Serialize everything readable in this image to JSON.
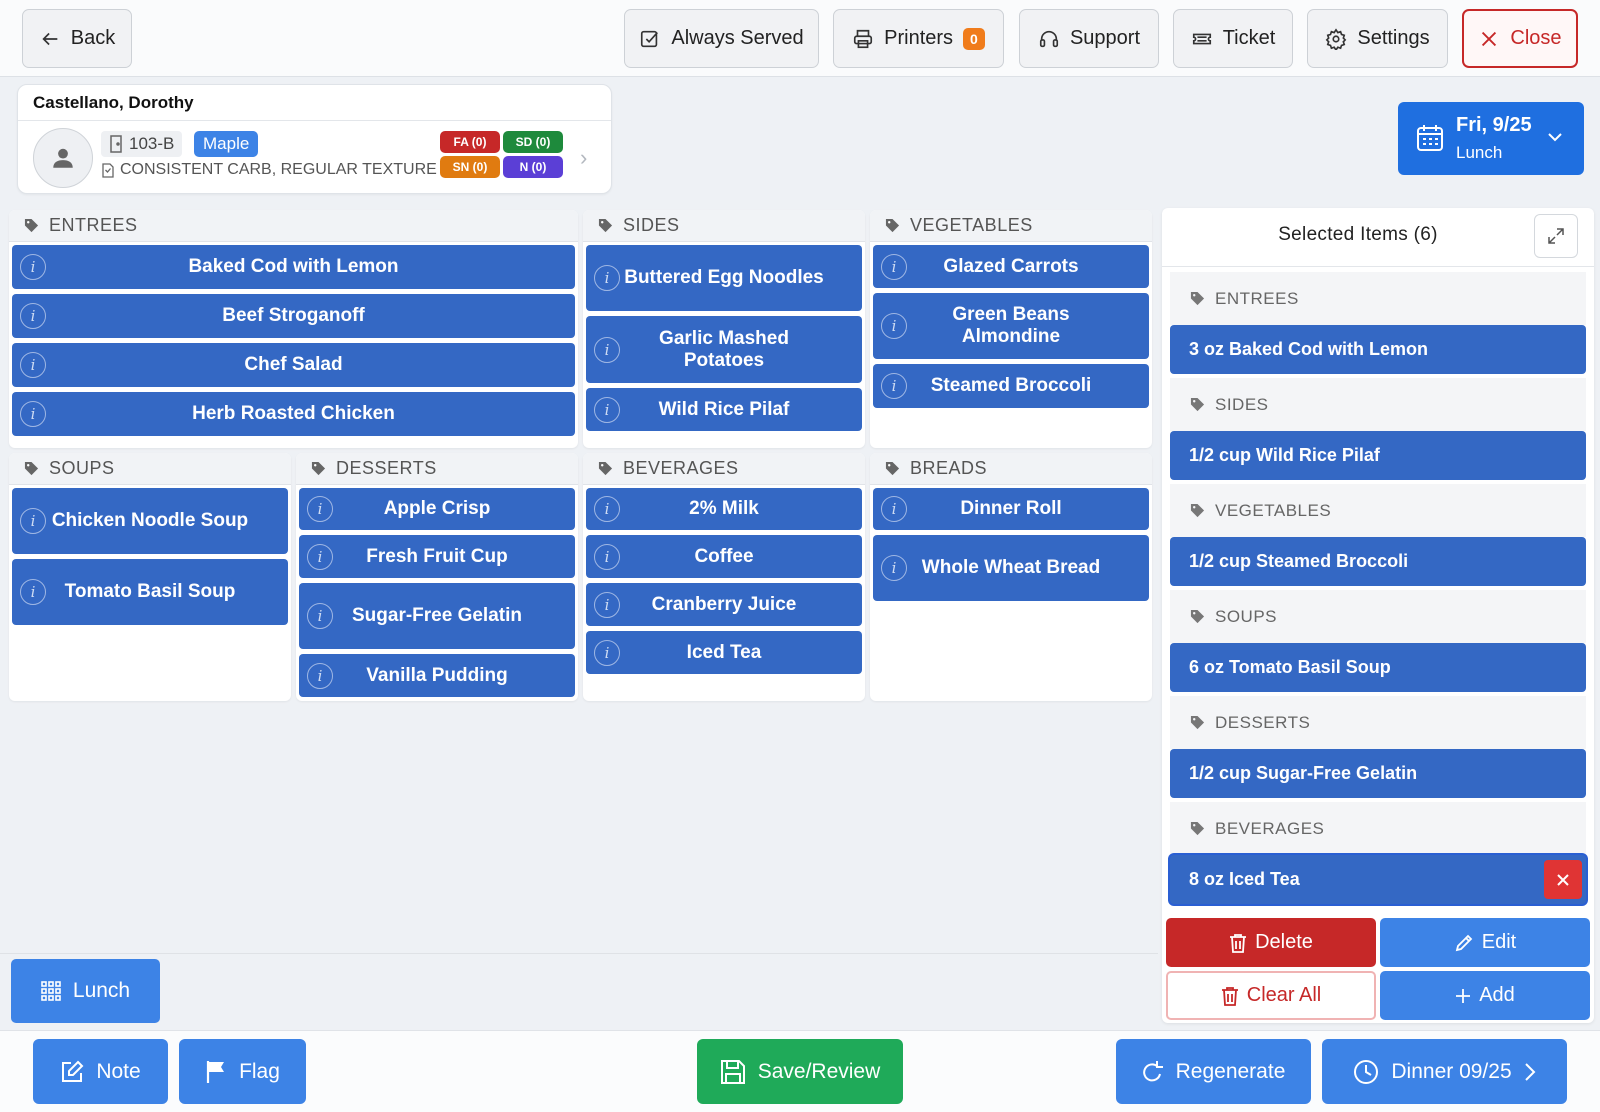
{
  "toolbar": {
    "back": "Back",
    "always_served": "Always Served",
    "printers": "Printers",
    "printers_count": "0",
    "support": "Support",
    "ticket": "Ticket",
    "settings": "Settings",
    "close": "Close"
  },
  "patient": {
    "name": "Castellano, Dorothy",
    "room": "103-B",
    "unit": "Maple",
    "diet": "CONSISTENT CARB, REGULAR TEXTURE",
    "tags": [
      {
        "label": "FA (0)",
        "color": "#c62828"
      },
      {
        "label": "SD (0)",
        "color": "#1e8a3c"
      },
      {
        "label": "SN (0)",
        "color": "#e07b10"
      },
      {
        "label": "N (0)",
        "color": "#5b3fd6"
      }
    ]
  },
  "date": {
    "day": "Fri, 9/25",
    "meal": "Lunch"
  },
  "menu": {
    "entrees": {
      "title": "ENTREES",
      "items": [
        "Baked Cod with Lemon",
        "Beef Stroganoff",
        "Chef Salad",
        "Herb Roasted Chicken"
      ]
    },
    "sides": {
      "title": "SIDES",
      "items": [
        "Buttered Egg Noodles",
        "Garlic Mashed Potatoes",
        "Wild Rice Pilaf"
      ]
    },
    "vegetables": {
      "title": "VEGETABLES",
      "items": [
        "Glazed Carrots",
        "Green Beans Almondine",
        "Steamed Broccoli"
      ]
    },
    "soups": {
      "title": "SOUPS",
      "items": [
        "Chicken Noodle Soup",
        "Tomato Basil Soup"
      ]
    },
    "desserts": {
      "title": "DESSERTS",
      "items": [
        "Apple Crisp",
        "Fresh Fruit Cup",
        "Sugar-Free Gelatin",
        "Vanilla Pudding"
      ]
    },
    "beverages": {
      "title": "BEVERAGES",
      "items": [
        "2% Milk",
        "Coffee",
        "Cranberry Juice",
        "Iced Tea"
      ]
    },
    "breads": {
      "title": "BREADS",
      "items": [
        "Dinner Roll",
        "Whole Wheat Bread"
      ]
    }
  },
  "selected": {
    "title": "Selected Items (6)",
    "groups": [
      {
        "category": "ENTREES",
        "item": "3 oz Baked Cod with Lemon"
      },
      {
        "category": "SIDES",
        "item": "1/2 cup Wild Rice Pilaf"
      },
      {
        "category": "VEGETABLES",
        "item": "1/2 cup Steamed Broccoli"
      },
      {
        "category": "SOUPS",
        "item": "6 oz Tomato Basil Soup"
      },
      {
        "category": "DESSERTS",
        "item": "1/2 cup Sugar-Free Gelatin"
      },
      {
        "category": "BEVERAGES",
        "item": "8 oz Iced Tea"
      }
    ],
    "delete": "Delete",
    "edit": "Edit",
    "clear_all": "Clear All",
    "add": "Add"
  },
  "meal_button": "Lunch",
  "bottom": {
    "note": "Note",
    "flag": "Flag",
    "save": "Save/Review",
    "regenerate": "Regenerate",
    "next_meal": "Dinner 09/25"
  },
  "colors": {
    "primary": "#3d83e6",
    "item_blue": "#3468c4",
    "danger": "#c62828",
    "success": "#1faa59",
    "badge": "#f07c1b"
  }
}
